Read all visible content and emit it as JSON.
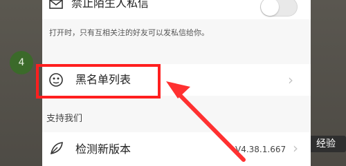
{
  "privacy": {
    "block_strangers_label": "禁止陌生人私信",
    "block_strangers_enabled": false,
    "hint": "打开时，只有互相关注的好友可以发私信给你。"
  },
  "blacklist": {
    "label": "黑名单列表",
    "icon": "face-icon"
  },
  "support": {
    "section_title": "支持我们",
    "check_update_label": "检测新版本",
    "version": "V4.38.1.667"
  },
  "tutorial": {
    "step_number": "4",
    "highlight_color": "#ff1f1f",
    "arrow_color": "#ff3131"
  },
  "watermark": {
    "text": "经验"
  }
}
